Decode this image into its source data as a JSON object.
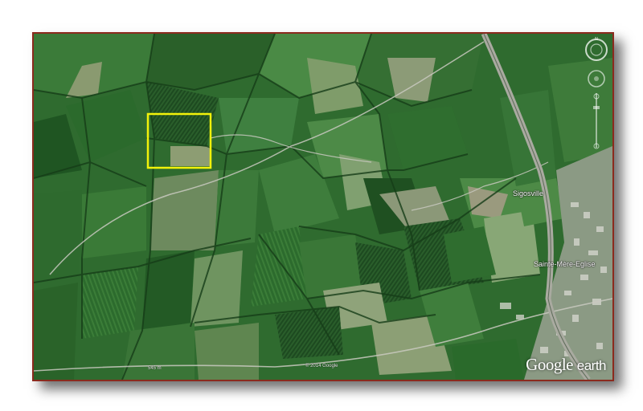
{
  "map": {
    "places": [
      {
        "name": "Sigosville"
      },
      {
        "name": "Sainte-Mère-Eglise"
      }
    ],
    "scale_label": "545 m",
    "copyright": "© 2014 Google",
    "logo": {
      "word1": "Google",
      "word2": "earth"
    },
    "highlight": {
      "color": "#f2f20a"
    }
  },
  "colors": {
    "border": "#8b2a1e",
    "field_dark": "#1f4f22",
    "field_mid": "#3a7a38",
    "field_light": "#6f9a5a",
    "road": "#c9c9c0"
  }
}
